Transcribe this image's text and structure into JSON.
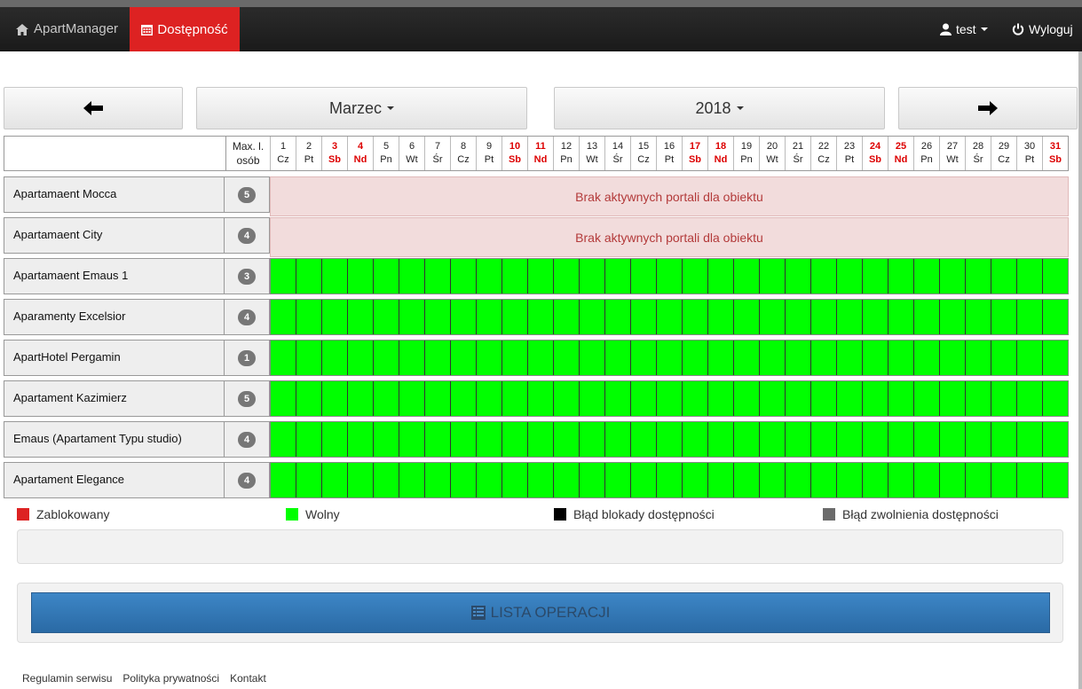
{
  "navbar": {
    "brand": "ApartManager",
    "active_tab": "Dostępność",
    "user": "test",
    "logout": "Wyloguj"
  },
  "controls": {
    "month": "Marzec",
    "year": "2018"
  },
  "calendar": {
    "max_header_line1": "Max. l.",
    "max_header_line2": "osób",
    "days": [
      {
        "n": "1",
        "d": "Cz",
        "we": false
      },
      {
        "n": "2",
        "d": "Pt",
        "we": false
      },
      {
        "n": "3",
        "d": "Sb",
        "we": true
      },
      {
        "n": "4",
        "d": "Nd",
        "we": true
      },
      {
        "n": "5",
        "d": "Pn",
        "we": false
      },
      {
        "n": "6",
        "d": "Wt",
        "we": false
      },
      {
        "n": "7",
        "d": "Śr",
        "we": false
      },
      {
        "n": "8",
        "d": "Cz",
        "we": false
      },
      {
        "n": "9",
        "d": "Pt",
        "we": false
      },
      {
        "n": "10",
        "d": "Sb",
        "we": true
      },
      {
        "n": "11",
        "d": "Nd",
        "we": true
      },
      {
        "n": "12",
        "d": "Pn",
        "we": false
      },
      {
        "n": "13",
        "d": "Wt",
        "we": false
      },
      {
        "n": "14",
        "d": "Śr",
        "we": false
      },
      {
        "n": "15",
        "d": "Cz",
        "we": false
      },
      {
        "n": "16",
        "d": "Pt",
        "we": false
      },
      {
        "n": "17",
        "d": "Sb",
        "we": true
      },
      {
        "n": "18",
        "d": "Nd",
        "we": true
      },
      {
        "n": "19",
        "d": "Pn",
        "we": false
      },
      {
        "n": "20",
        "d": "Wt",
        "we": false
      },
      {
        "n": "21",
        "d": "Śr",
        "we": false
      },
      {
        "n": "22",
        "d": "Cz",
        "we": false
      },
      {
        "n": "23",
        "d": "Pt",
        "we": false
      },
      {
        "n": "24",
        "d": "Sb",
        "we": true
      },
      {
        "n": "25",
        "d": "Nd",
        "we": true
      },
      {
        "n": "26",
        "d": "Pn",
        "we": false
      },
      {
        "n": "27",
        "d": "Wt",
        "we": false
      },
      {
        "n": "28",
        "d": "Śr",
        "we": false
      },
      {
        "n": "29",
        "d": "Cz",
        "we": false
      },
      {
        "n": "30",
        "d": "Pt",
        "we": false
      },
      {
        "n": "31",
        "d": "Sb",
        "we": true
      }
    ],
    "no_portal_msg": "Brak aktywnych portali dla obiektu",
    "rows": [
      {
        "name": "Apartamaent Mocca",
        "max": "5",
        "status": "none"
      },
      {
        "name": "Apartamaent City",
        "max": "4",
        "status": "none"
      },
      {
        "name": "Apartamaent Emaus 1",
        "max": "3",
        "status": "free"
      },
      {
        "name": "Aparamenty Excelsior",
        "max": "4",
        "status": "free"
      },
      {
        "name": "ApartHotel Pergamin",
        "max": "1",
        "status": "free"
      },
      {
        "name": "Apartament Kazimierz",
        "max": "5",
        "status": "free"
      },
      {
        "name": "Emaus (Apartament Typu studio)",
        "max": "4",
        "status": "free"
      },
      {
        "name": "Apartament Elegance",
        "max": "4",
        "status": "free"
      }
    ]
  },
  "legend": [
    {
      "label": "Zablokowany",
      "color": "#dd2222"
    },
    {
      "label": "Wolny",
      "color": "#00ff00"
    },
    {
      "label": "Błąd blokady dostępności",
      "color": "#000000"
    },
    {
      "label": "Błąd zwolnienia dostępności",
      "color": "#6b6b6b"
    }
  ],
  "list_button": "LISTA OPERACJI",
  "footer": [
    "Regulamin serwisu",
    "Polityka prywatności",
    "Kontakt"
  ]
}
